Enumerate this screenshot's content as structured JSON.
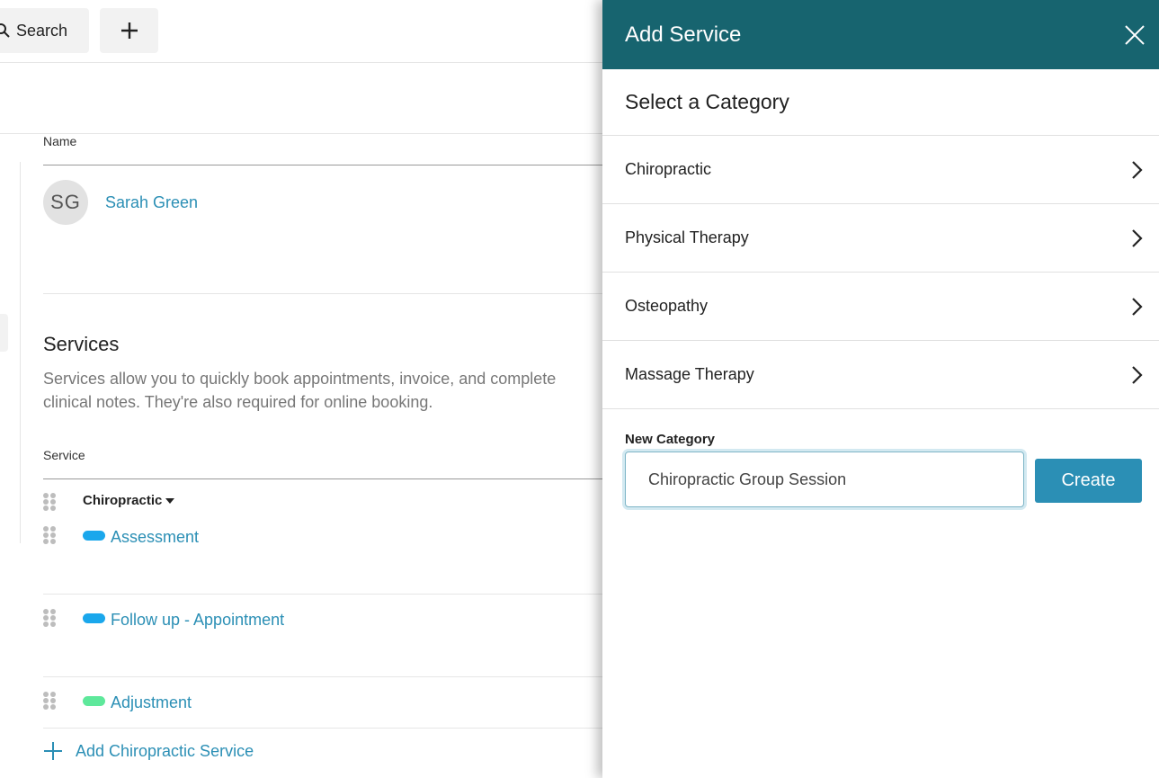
{
  "topbar": {
    "search_label": "Search",
    "search_icon": "search-icon",
    "add_icon": "plus-icon"
  },
  "profile": {
    "name_header": "Name",
    "avatar_initials": "SG",
    "person_name": "Sarah Green"
  },
  "services": {
    "title": "Services",
    "description": "Services allow you to quickly book appointments, invoice, and complete clinical notes. They're also required for online booking.",
    "column_header": "Service",
    "category": "Chiropractic",
    "items": [
      {
        "label": "Assessment",
        "color": "#1aa7ec"
      },
      {
        "label": "Follow up - Appointment",
        "color": "#1aa7ec"
      },
      {
        "label": "Adjustment",
        "color": "#5ee89b"
      }
    ],
    "add_label": "Add Chiropractic Service"
  },
  "drawer": {
    "title": "Add Service",
    "header_color": "#17646f",
    "select_title": "Select a Category",
    "categories": [
      "Chiropractic",
      "Physical Therapy",
      "Osteopathy",
      "Massage Therapy"
    ],
    "new_category_label": "New Category",
    "new_category_value": "Chiropractic Group Session",
    "create_label": "Create"
  },
  "accent_color": "#2b8fb5"
}
